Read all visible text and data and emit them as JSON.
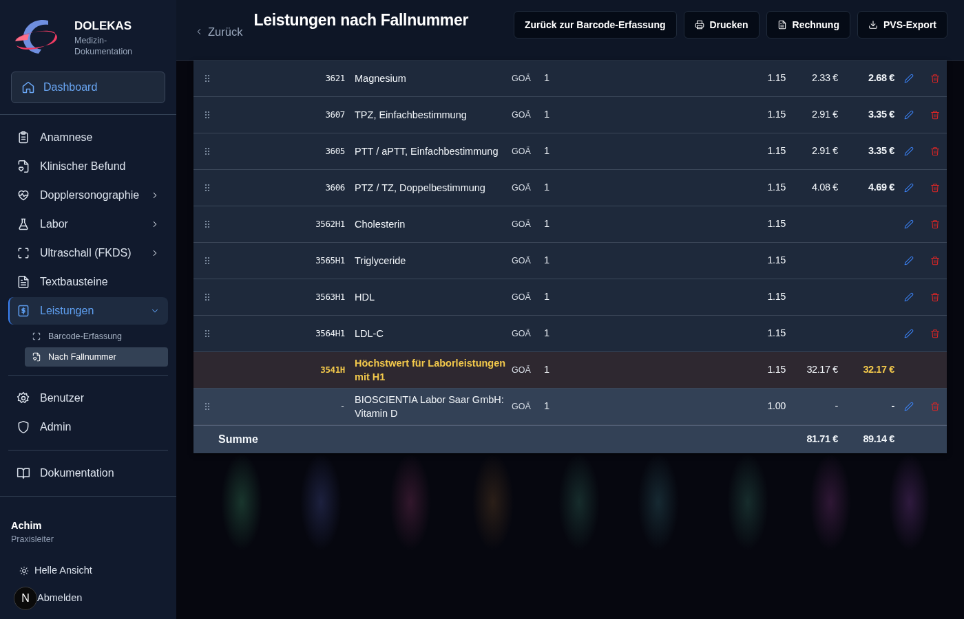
{
  "sidebar": {
    "brand": {
      "title": "DOLEKAS",
      "subtitle": "Medizin-Dokumentation"
    },
    "dashboard": {
      "label": "Dashboard",
      "selected": true
    },
    "groups": [
      [
        {
          "label": "Anamnese",
          "selected": false
        },
        {
          "label": "Klinischer Befund",
          "selected": false
        },
        {
          "label": "Dopplersonographie",
          "selected": false,
          "expanded": false
        },
        {
          "label": "Labor",
          "selected": false,
          "expanded": false
        },
        {
          "label": "Ultraschall (FKDS)",
          "selected": false,
          "expanded": false
        },
        {
          "label": "Textbausteine",
          "selected": false
        },
        {
          "label": "Leistungen",
          "selected": true,
          "expanded": true,
          "children": [
            {
              "label": "Barcode-Erfassung",
              "selected": false
            },
            {
              "label": "Nach Fallnummer",
              "selected": true
            }
          ]
        }
      ],
      [
        {
          "label": "Benutzer",
          "selected": false
        },
        {
          "label": "Admin",
          "selected": false
        }
      ],
      [
        {
          "label": "Dokumentation",
          "selected": false
        }
      ]
    ],
    "user": {
      "name": "Achim",
      "role": "Praxisleiter"
    },
    "actions": [
      "Helle Ansicht",
      "Abmelden"
    ],
    "avatar": "N"
  },
  "header": {
    "back": "Zurück",
    "title": "Leistungen nach Fallnummer",
    "buttons": [
      "Zurück zur Barcode-Erfassung",
      "Drucken",
      "Rechnung",
      "PVS-Export"
    ]
  },
  "table": {
    "rows": [
      {
        "kind": "service",
        "code": "3621",
        "name": "Magnesium",
        "catalog": "GOÄ",
        "qty": "1",
        "factor": "1.15",
        "price": "2.33 €",
        "total": "2.68 €"
      },
      {
        "kind": "service",
        "code": "3607",
        "name": "TPZ, Einfachbestimmung",
        "catalog": "GOÄ",
        "qty": "1",
        "factor": "1.15",
        "price": "2.91 €",
        "total": "3.35 €"
      },
      {
        "kind": "service",
        "code": "3605",
        "name": "PTT / aPTT, Einfachbestimmung",
        "catalog": "GOÄ",
        "qty": "1",
        "factor": "1.15",
        "price": "2.91 €",
        "total": "3.35 €"
      },
      {
        "kind": "service",
        "code": "3606",
        "name": "PTZ / TZ, Doppelbestimmung",
        "catalog": "GOÄ",
        "qty": "1",
        "factor": "1.15",
        "price": "4.08 €",
        "total": "4.69 €"
      },
      {
        "kind": "service",
        "code": "3562H1",
        "name": "Cholesterin",
        "catalog": "GOÄ",
        "qty": "1",
        "factor": "1.15"
      },
      {
        "kind": "service",
        "code": "3565H1",
        "name": "Triglyceride",
        "catalog": "GOÄ",
        "qty": "1",
        "factor": "1.15"
      },
      {
        "kind": "service",
        "code": "3563H1",
        "name": "HDL",
        "catalog": "GOÄ",
        "qty": "1",
        "factor": "1.15"
      },
      {
        "kind": "service",
        "code": "3564H1",
        "name": "LDL-C",
        "catalog": "GOÄ",
        "qty": "1",
        "factor": "1.15"
      },
      {
        "kind": "cap",
        "code": "3541H",
        "name": "Höchstwert für Laborleistungen mit H1",
        "catalog": "GOÄ",
        "qty": "1",
        "factor": "1.15",
        "price": "32.17 €",
        "total": "32.17 €"
      },
      {
        "kind": "external",
        "code": "-",
        "name": "BIOSCIENTIA Labor Saar GmbH: Vitamin D",
        "catalog": "GOÄ",
        "qty": "1",
        "factor": "1.00",
        "price": "-",
        "total": "-"
      }
    ],
    "sum": {
      "label": "Summe",
      "price": "81.71 €",
      "total": "89.14 €"
    }
  }
}
